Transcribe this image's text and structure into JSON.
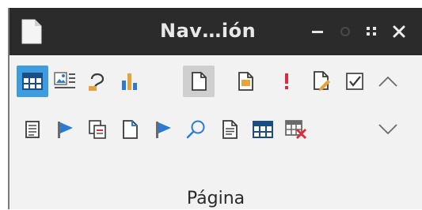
{
  "window": {
    "title": "Nav…ión",
    "controls": {
      "minimize": "–",
      "close": "×"
    }
  },
  "toolbar": {
    "row1": [
      {
        "name": "table-icon",
        "state": "active"
      },
      {
        "name": "image-icon"
      },
      {
        "name": "shape-icon"
      },
      {
        "name": "chart-icon"
      },
      {
        "name": "page-icon",
        "state": "selected"
      },
      {
        "name": "note-icon"
      },
      {
        "name": "exclamation-icon"
      },
      {
        "name": "edit-document-icon"
      },
      {
        "name": "checkbox-icon"
      },
      {
        "name": "chevron-up-icon"
      }
    ],
    "row2": [
      {
        "name": "list-document-icon"
      },
      {
        "name": "flag-icon"
      },
      {
        "name": "copy-document-icon"
      },
      {
        "name": "page-corner-icon"
      },
      {
        "name": "flag-icon"
      },
      {
        "name": "search-icon"
      },
      {
        "name": "text-document-icon"
      },
      {
        "name": "table-icon"
      },
      {
        "name": "delete-table-icon"
      },
      {
        "name": "chevron-down-icon"
      }
    ]
  },
  "footer": {
    "label": "Página"
  },
  "colors": {
    "titlebar": "#2b2b2b",
    "accent": "#3d9ddf",
    "flag": "#2a7bd1",
    "exclamation": "#e0283a",
    "note": "#e8a23a"
  }
}
